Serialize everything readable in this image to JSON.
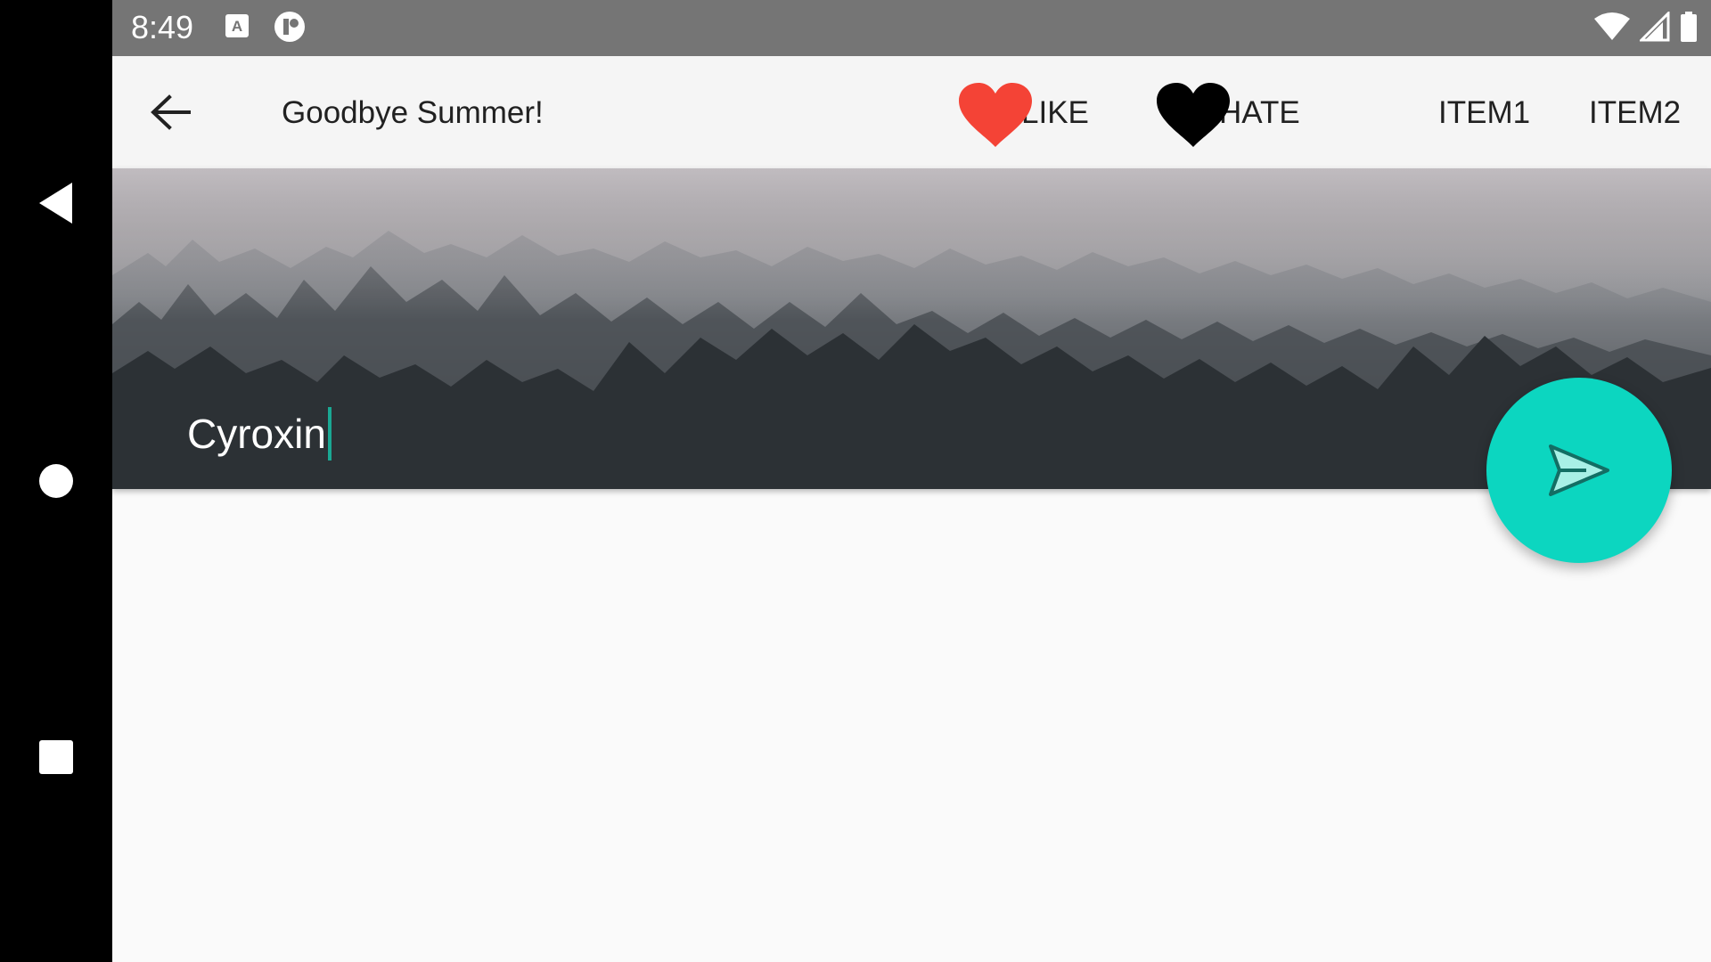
{
  "status_bar": {
    "time": "8:49",
    "left_icons": [
      "keyboard-a-icon",
      "notification-badge-icon"
    ],
    "right_icons": [
      "wifi-icon",
      "cellular-signal-icon",
      "battery-icon"
    ]
  },
  "toolbar": {
    "back_icon": "arrow-left-icon",
    "title": "Goodbye Summer!",
    "actions": [
      {
        "label": "LIKE",
        "icon": "heart-icon",
        "icon_color": "#f44336"
      },
      {
        "label": "HATE",
        "icon": "heart-icon",
        "icon_color": "#000000"
      },
      {
        "label": "ITEM1"
      },
      {
        "label": "ITEM2"
      }
    ]
  },
  "header_image": {
    "description_icon": "foggy-forest-image",
    "title_text": "Cyroxin"
  },
  "fab": {
    "icon": "send-icon",
    "color": "#0cd6c0"
  },
  "nav_bar": {
    "buttons": [
      "back-triangle-icon",
      "home-circle-icon",
      "recents-square-icon"
    ]
  },
  "colors": {
    "status_bar": "#757575",
    "toolbar": "#f5f5f5",
    "accent": "#1aa893",
    "like_heart": "#f44336"
  }
}
